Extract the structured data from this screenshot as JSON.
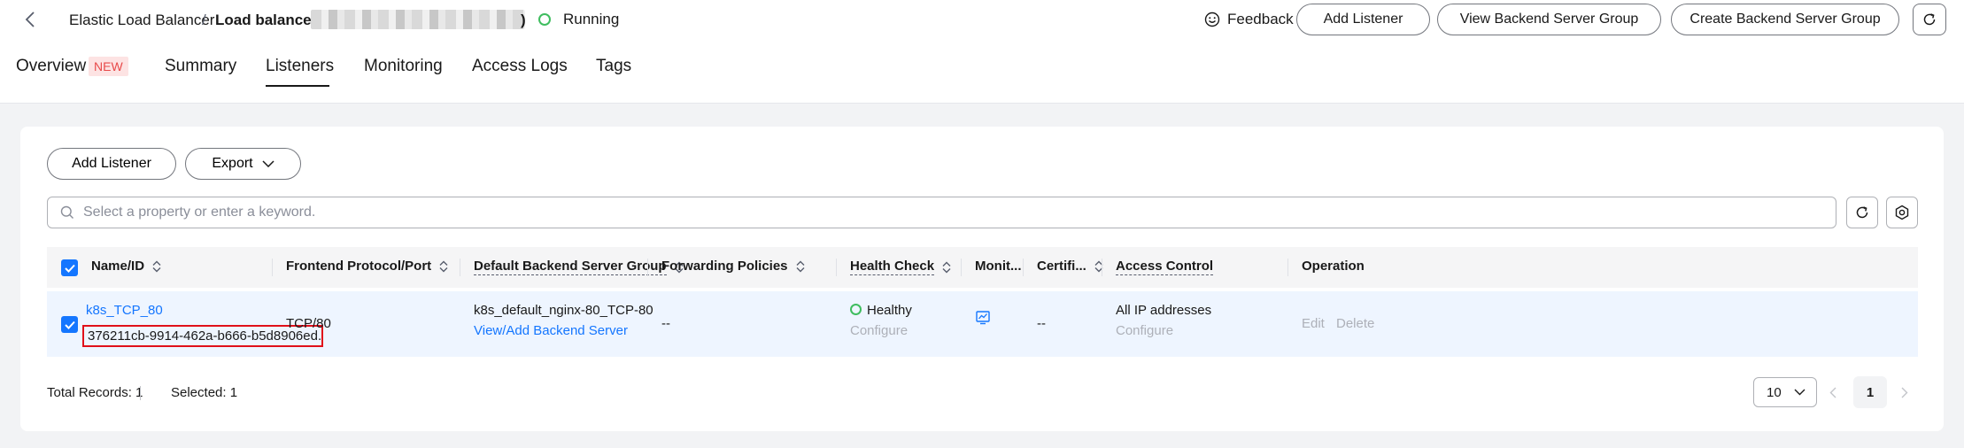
{
  "header": {
    "breadcrumb_parent": "Elastic Load Balancer",
    "breadcrumb_sep": "/",
    "breadcrumb_current": "Load balancer (",
    "breadcrumb_close": ")",
    "status": "Running",
    "feedback": "Feedback",
    "add_listener": "Add Listener",
    "view_bsg": "View Backend Server Group",
    "create_bsg": "Create Backend Server Group"
  },
  "tabs": [
    {
      "label": "Overview",
      "badge": "NEW"
    },
    {
      "label": "Summary"
    },
    {
      "label": "Listeners",
      "active": true
    },
    {
      "label": "Monitoring"
    },
    {
      "label": "Access Logs"
    },
    {
      "label": "Tags"
    }
  ],
  "toolbar": {
    "add_listener": "Add Listener",
    "export": "Export",
    "search_placeholder": "Select a property or enter a keyword."
  },
  "table": {
    "columns": [
      "Name/ID",
      "Frontend Protocol/Port",
      "Default Backend Server Group",
      "Forwarding Policies",
      "Health Check",
      "Monit...",
      "Certifi...",
      "Access Control",
      "Operation"
    ],
    "rows": [
      {
        "name": "k8s_TCP_80",
        "id": "376211cb-9914-462a-b666-b5d8906ed...",
        "protocol_port": "TCP/80",
        "backend_group": "k8s_default_nginx-80_TCP-80",
        "backend_link": "View/Add Backend Server",
        "forwarding": "--",
        "health": "Healthy",
        "health_link": "Configure",
        "certificates": "--",
        "access_control": "All IP addresses",
        "access_link": "Configure",
        "op_edit": "Edit",
        "op_delete": "Delete"
      }
    ]
  },
  "footer": {
    "total": "Total Records: 1",
    "selected": "Selected: 1",
    "page_size": "10",
    "current_page": "1"
  },
  "colors": {
    "accent": "#1476ff",
    "healthy": "#3fbd5f",
    "highlight_border": "#e0101a"
  }
}
